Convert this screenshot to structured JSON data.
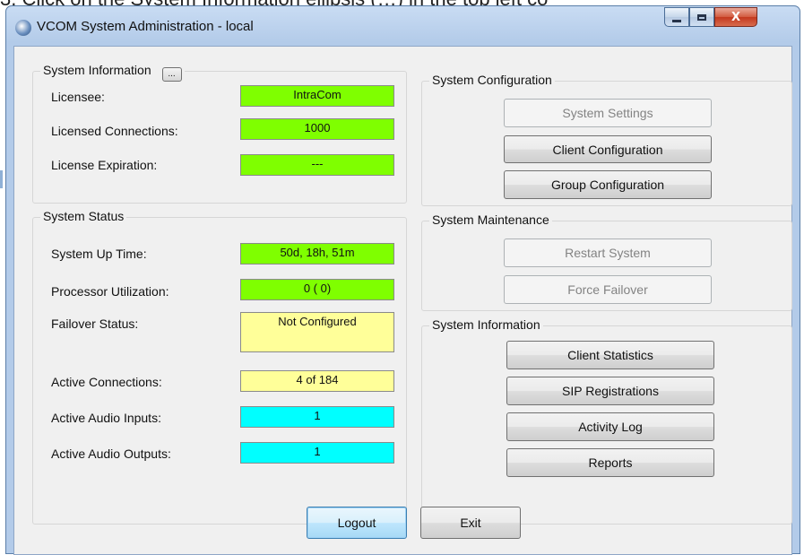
{
  "top_caption": "3. Click on the System Information ellipsis (…) in the top left co",
  "window": {
    "title": "VCOM System Administration - local",
    "minimize_label": "",
    "maximize_label": "",
    "close_label": "X"
  },
  "system_information_group": {
    "title": "System Information",
    "ellipsis_label": "...",
    "rows": [
      {
        "label": "Licensee:",
        "value": "IntraCom"
      },
      {
        "label": "Licensed Connections:",
        "value": "1000"
      },
      {
        "label": "License Expiration:",
        "value": "---"
      }
    ]
  },
  "system_status_group": {
    "title": "System Status",
    "rows": [
      {
        "label": "System Up Time:",
        "value": "50d, 18h, 51m"
      },
      {
        "label": "Processor Utilization:",
        "value": "0 ( 0)"
      },
      {
        "label": "Failover Status:",
        "value": "Not Configured"
      },
      {
        "label": "Active Connections:",
        "value": "4 of 184"
      },
      {
        "label": "Active Audio Inputs:",
        "value": "1"
      },
      {
        "label": "Active Audio Outputs:",
        "value": "1"
      }
    ]
  },
  "system_configuration_group": {
    "title": "System Configuration",
    "buttons": [
      {
        "label": "System Settings",
        "enabled": false
      },
      {
        "label": "Client Configuration",
        "enabled": true
      },
      {
        "label": "Group Configuration",
        "enabled": true
      }
    ]
  },
  "system_maintenance_group": {
    "title": "System Maintenance",
    "buttons": [
      {
        "label": "Restart System",
        "enabled": false
      },
      {
        "label": "Force Failover",
        "enabled": false
      }
    ]
  },
  "system_information_right_group": {
    "title": "System Information",
    "buttons": [
      {
        "label": "Client Statistics",
        "enabled": true
      },
      {
        "label": "SIP Registrations",
        "enabled": true
      },
      {
        "label": "Activity Log",
        "enabled": true
      },
      {
        "label": "Reports",
        "enabled": true
      }
    ]
  },
  "footer": {
    "logout_label": "Logout",
    "exit_label": "Exit"
  },
  "colors": {
    "status_green": "#7fff00",
    "status_yellow": "#ffff99",
    "status_cyan": "#00ffff",
    "window_frame": "#b3cbe9",
    "client_bg": "#f0f0f0"
  }
}
